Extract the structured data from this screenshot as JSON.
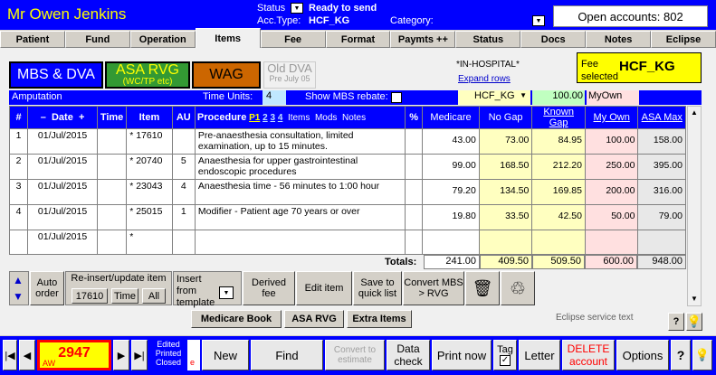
{
  "patient_name": "Mr Owen Jenkins",
  "header": {
    "status_label": "Status",
    "status_value": "Ready to send",
    "acc_type_label": "Acc.Type:",
    "acc_type_value": "HCF_KG",
    "category_label": "Category:",
    "open_accounts": "Open accounts: 802"
  },
  "tabs": [
    "Patient",
    "Fund",
    "Operation",
    "Items",
    "Fee",
    "Format",
    "Paymts ++",
    "Status",
    "Docs",
    "Notes",
    "Eclipse"
  ],
  "active_tab": "Items",
  "fee_buttons": {
    "mbs": "MBS & DVA",
    "asa": "ASA RVG",
    "asa_sub": "(WC/TP etc)",
    "wag": "WAG",
    "old_dva": "Old DVA",
    "old_dva_sub": "Pre July 05"
  },
  "in_hospital": "*IN-HOSPITAL*",
  "expand_rows": "Expand rows",
  "fee_selected": {
    "label1": "Fee",
    "label2": "selected",
    "value": "HCF_KG"
  },
  "bar": {
    "description": "Amputation",
    "time_units_label": "Time Units:",
    "time_units": "4",
    "rebate_label": "Show MBS rebate:",
    "fund": "HCF_KG",
    "amount": "100.00",
    "myown": "MyOwn"
  },
  "columns": {
    "num": "#",
    "date": "Date",
    "time": "Time",
    "item": "Item",
    "au": "AU",
    "proc": "Procedure",
    "p": "P1",
    "p2": "2",
    "p3": "3",
    "p4": "4",
    "items": "Items",
    "mods": "Mods",
    "notes": "Notes",
    "pct": "%",
    "medicare": "Medicare",
    "nogap": "No Gap",
    "knowngap": "Known Gap",
    "myown": "My Own",
    "asamax": "ASA Max",
    "date_minus": "–",
    "date_plus": "+"
  },
  "rows": [
    {
      "num": "1",
      "date": "01/Jul/2015",
      "item": "17610",
      "au": "",
      "proc": "Pre-anaesthesia consultation, limited examination, up to 15 minutes.",
      "medicare": "43.00",
      "nogap": "73.00",
      "knowngap": "84.95",
      "myown": "100.00",
      "asamax": "158.00"
    },
    {
      "num": "2",
      "date": "01/Jul/2015",
      "item": "20740",
      "au": "5",
      "proc": "Anaesthesia for upper gastrointestinal endoscopic procedures",
      "medicare": "99.00",
      "nogap": "168.50",
      "knowngap": "212.20",
      "myown": "250.00",
      "asamax": "395.00"
    },
    {
      "num": "3",
      "date": "01/Jul/2015",
      "item": "23043",
      "au": "4",
      "proc": "Anaesthesia time - 56 minutes to 1:00 hour",
      "medicare": "79.20",
      "nogap": "134.50",
      "knowngap": "169.85",
      "myown": "200.00",
      "asamax": "316.00"
    },
    {
      "num": "4",
      "date": "01/Jul/2015",
      "item": "25015",
      "au": "1",
      "proc": "Modifier - Patient age 70 years or over",
      "medicare": "19.80",
      "nogap": "33.50",
      "knowngap": "42.50",
      "myown": "50.00",
      "asamax": "79.00"
    },
    {
      "num": "",
      "date": "01/Jul/2015",
      "item": "",
      "au": "",
      "proc": "",
      "medicare": "",
      "nogap": "",
      "knowngap": "",
      "myown": "",
      "asamax": ""
    }
  ],
  "totals": {
    "label": "Totals:",
    "medicare": "241.00",
    "nogap": "409.50",
    "knowngap": "509.50",
    "myown": "600.00",
    "asamax": "948.00"
  },
  "actions": {
    "auto_order": "Auto order",
    "reinsert": "Re-insert/update item",
    "item_no": "17610",
    "time": "Time",
    "all": "All",
    "insert_template": "Insert from template",
    "derived_fee": "Derived fee",
    "edit_item": "Edit item",
    "save_quick": "Save to quick list",
    "convert": "Convert MBS > RVG"
  },
  "book_buttons": [
    "Medicare Book",
    "ASA RVG",
    "Extra Items"
  ],
  "eclipse_text": "Eclipse service text",
  "bottom": {
    "account_no": "2947",
    "aw": "AW",
    "state": [
      "Edited",
      "Printed",
      "Closed"
    ],
    "new": "New",
    "find": "Find",
    "convert_estimate": "Convert to estimate",
    "data_check": "Data check",
    "print_now": "Print now",
    "tag": "Tag",
    "letter": "Letter",
    "delete": "DELETE account",
    "options": "Options"
  },
  "colors": {
    "blue": "#0000ff",
    "yellow": "#ffff00",
    "mbs_blue": "#0000ff",
    "asa_green": "#339933",
    "wag_orange": "#cc6600",
    "red": "#ff0000"
  }
}
